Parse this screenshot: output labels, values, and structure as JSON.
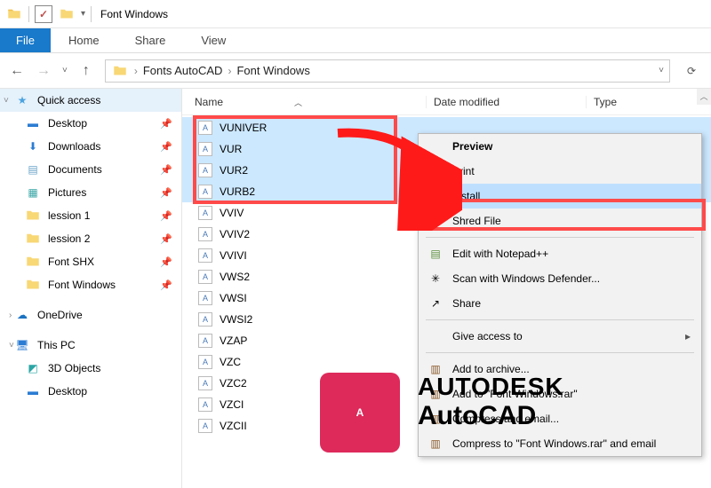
{
  "title": "Font Windows",
  "ribbon": {
    "file": "File",
    "tabs": [
      "Home",
      "Share",
      "View"
    ]
  },
  "breadcrumbs": [
    "Fonts AutoCAD",
    "Font Windows"
  ],
  "columns": {
    "name": "Name",
    "date": "Date modified",
    "type": "Type"
  },
  "sidebar": {
    "quick_access": "Quick access",
    "items": [
      {
        "label": "Desktop",
        "icon": "desktop",
        "pinned": true
      },
      {
        "label": "Downloads",
        "icon": "downloads",
        "pinned": true
      },
      {
        "label": "Documents",
        "icon": "documents",
        "pinned": true
      },
      {
        "label": "Pictures",
        "icon": "pictures",
        "pinned": true
      },
      {
        "label": "lession 1",
        "icon": "folder",
        "pinned": true
      },
      {
        "label": "lession 2",
        "icon": "folder",
        "pinned": true
      },
      {
        "label": "Font SHX",
        "icon": "folder",
        "pinned": true
      },
      {
        "label": "Font Windows",
        "icon": "folder",
        "pinned": true
      }
    ],
    "onedrive": "OneDrive",
    "thispc": "This PC",
    "thispc_items": [
      "3D Objects",
      "Desktop"
    ]
  },
  "files": {
    "selected": [
      "VUNIVER",
      "VUR",
      "VUR2",
      "VURB2"
    ],
    "rest": [
      "VVIV",
      "VVIV2",
      "VVIVI",
      "VWS2",
      "VWSI",
      "VWSI2",
      "VZAP",
      "VZC",
      "VZC2",
      "VZCI",
      "VZCII"
    ]
  },
  "context": {
    "preview": "Preview",
    "print": "Print",
    "install": "Install",
    "shred": "Shred File",
    "notepad": "Edit with Notepad++",
    "defender": "Scan with Windows Defender...",
    "share": "Share",
    "give_access": "Give access to",
    "add_rar": "Add to \"Font Windows.rar\"",
    "compress_email": "Compress and email...",
    "compress_to_email": "Compress to \"Font Windows.rar\" and email",
    "add_archive": "Add to archive..."
  },
  "brand": {
    "logo": "A",
    "line1": "AUTODESK",
    "line2": "AutoCAD"
  },
  "colors": {
    "accent": "#1979ca",
    "highlight": "#ff4a4a",
    "brand": "#dd2a5b"
  }
}
